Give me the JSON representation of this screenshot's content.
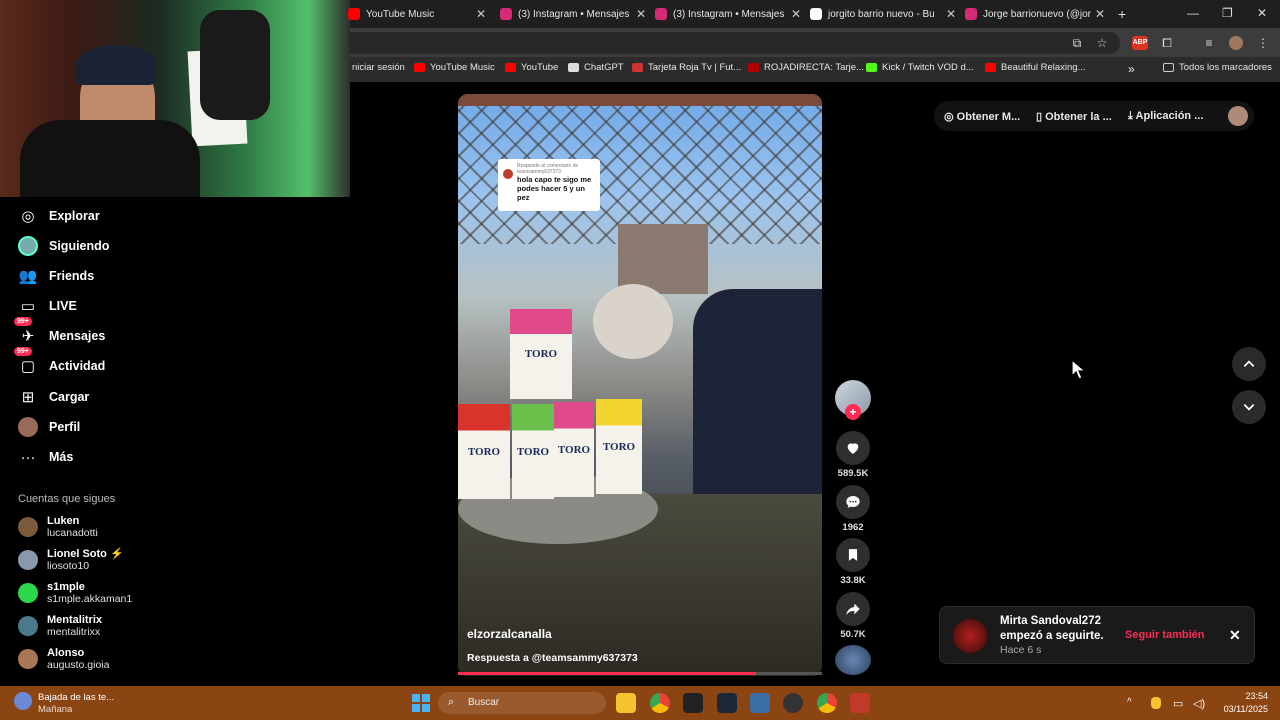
{
  "browser": {
    "tabs": [
      {
        "title": "YouTube Music",
        "color": "#ff0000"
      },
      {
        "title": "(3) Instagram • Mensajes",
        "color": "#d62976"
      },
      {
        "title": "(3) Instagram • Mensajes",
        "color": "#d62976"
      },
      {
        "title": "jorgito barrio nuevo - Bu",
        "color": "#ffffff"
      },
      {
        "title": "Jorge barrionuevo (@jor",
        "color": "#d62976"
      }
    ],
    "new_tab": "+",
    "window_controls": {
      "minimize": "—",
      "maximize": "❐",
      "close": "✕"
    },
    "bookmarks": [
      {
        "label": "niciar sesión",
        "color": "#2b2b2b"
      },
      {
        "label": "YouTube Music",
        "color": "#ff0000"
      },
      {
        "label": "YouTube",
        "color": "#ff0000"
      },
      {
        "label": "ChatGPT",
        "color": "#dddddd"
      },
      {
        "label": "Tarjeta Roja Tv | Fut...",
        "color": "#cc3333"
      },
      {
        "label": "ROJADIRECTA: Tarje...",
        "color": "#b30000"
      },
      {
        "label": "Kick / Twitch VOD d...",
        "color": "#53fc18"
      },
      {
        "label": "Beautiful Relaxing...",
        "color": "#ff0000"
      }
    ],
    "bookmarks_more": "»",
    "all_bookmarks": "Todos los marcadores"
  },
  "sidebar": {
    "items": [
      {
        "label": "Explorar",
        "icon": "compass-icon",
        "glyph": "◎"
      },
      {
        "label": "Siguiendo",
        "icon": "following-avatar-icon",
        "glyph": ""
      },
      {
        "label": "Friends",
        "icon": "friends-icon",
        "glyph": "👥"
      },
      {
        "label": "LIVE",
        "icon": "live-icon",
        "glyph": "▭"
      },
      {
        "label": "Mensajes",
        "icon": "messages-icon",
        "glyph": "✈",
        "badge": "99+"
      },
      {
        "label": "Actividad",
        "icon": "activity-icon",
        "glyph": "▢",
        "badge": "99+"
      },
      {
        "label": "Cargar",
        "icon": "upload-icon",
        "glyph": "⊞"
      },
      {
        "label": "Perfil",
        "icon": "profile-avatar-icon",
        "glyph": ""
      },
      {
        "label": "Más",
        "icon": "more-icon",
        "glyph": "···"
      }
    ],
    "following_title": "Cuentas que sigues",
    "accounts": [
      {
        "name": "Luken",
        "handle": "lucanadotti",
        "color": "#7a5a3a"
      },
      {
        "name": "Lionel Soto",
        "handle": "liosoto10",
        "color": "#8899aa",
        "mark": "⚡"
      },
      {
        "name": "s1mple",
        "handle": "s1mple.akkaman1",
        "color": "#2bd84a"
      },
      {
        "name": "Mentalitrix",
        "handle": "mentalitrixx",
        "color": "#4a7a8a"
      },
      {
        "name": "Alonso",
        "handle": "augusto.gioia",
        "color": "#aa7755"
      }
    ]
  },
  "video": {
    "author": "elzorzalcanalla",
    "caption": "Respuesta a @teamsammy637373",
    "reply_header": "Responde al comentario de teamsammy637373",
    "reply_text": "hola capo te sigo me podes hacer 5 y un pez",
    "box_brand": "TORO",
    "progress": 0.82
  },
  "actions": {
    "likes": "589.5K",
    "comments": "1962",
    "saves": "33.8K",
    "shares": "50.7K"
  },
  "top_pill": {
    "item1": "Obtener M...",
    "item2": "Obtener la ...",
    "item3": "Aplicación ..."
  },
  "notification": {
    "user": "Mirta Sandoval272",
    "message": "empezó a seguirte.",
    "time": "Hace 6 s",
    "action": "Seguir también",
    "close": "✕"
  },
  "taskbar": {
    "weather_title": "Bajada de las te...",
    "weather_sub": "Mañana",
    "search": "Buscar",
    "time": "23:54",
    "date": "03/11/2025",
    "tray_chevron": "^"
  },
  "colors": {
    "accent": "#fe2c55",
    "taskbar": "#8b4512"
  }
}
